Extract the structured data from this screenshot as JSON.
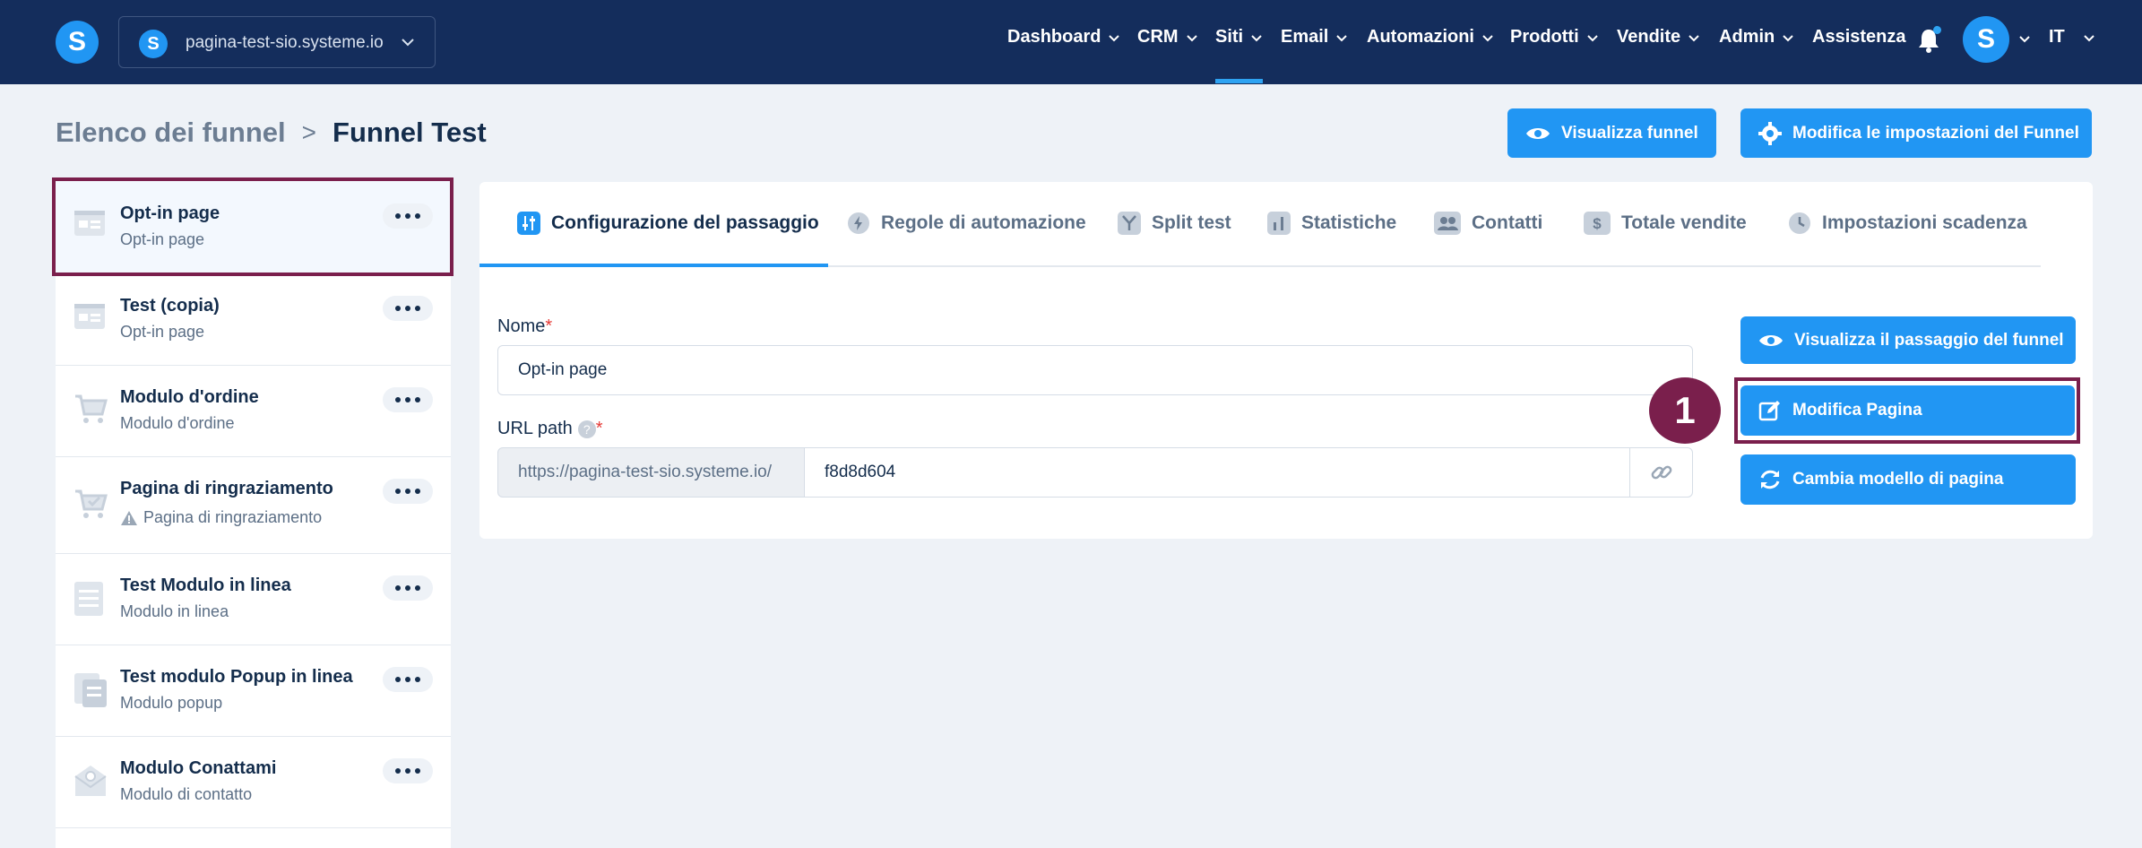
{
  "header": {
    "site_name": "pagina-test-sio.systeme.io",
    "logo_letter": "S",
    "nav": [
      "Dashboard",
      "CRM",
      "Siti",
      "Email",
      "Automazioni",
      "Prodotti",
      "Vendite",
      "Admin",
      "Assistenza"
    ],
    "active_nav": "Siti",
    "language": "IT",
    "avatar_letter": "S"
  },
  "breadcrumb": {
    "parent": "Elenco dei funnel",
    "separator": ">",
    "current": "Funnel Test"
  },
  "top_actions": {
    "view_funnel": "Visualizza funnel",
    "funnel_settings": "Modifica le impostazioni del Funnel"
  },
  "steps": [
    {
      "title": "Opt-in page",
      "subtitle": "Opt-in page",
      "icon": "optin-page-icon",
      "selected": true
    },
    {
      "title": "Test (copia)",
      "subtitle": "Opt-in page",
      "icon": "optin-page-icon"
    },
    {
      "title": "Modulo d'ordine",
      "subtitle": "Modulo d'ordine",
      "icon": "cart-icon"
    },
    {
      "title": "Pagina di ringraziamento",
      "subtitle": "Pagina di ringraziamento",
      "icon": "cart-check-icon",
      "warning": true
    },
    {
      "title": "Test Modulo in linea",
      "subtitle": "Modulo in linea",
      "icon": "form-icon"
    },
    {
      "title": "Test modulo Popup in linea",
      "subtitle": "Modulo popup",
      "icon": "popup-icon"
    },
    {
      "title": "Modulo Conattami",
      "subtitle": "Modulo di contatto",
      "icon": "contact-mail-icon"
    }
  ],
  "tabs": [
    "Configurazione del passaggio",
    "Regole di automazione",
    "Split test",
    "Statistiche",
    "Contatti",
    "Totale vendite",
    "Impostazioni scadenza"
  ],
  "form": {
    "name_label": "Nome",
    "name_value": "Opt-in page",
    "url_label": "URL path",
    "required_mark": "*",
    "help_mark": "?",
    "url_prefix": "https://pagina-test-sio.systeme.io/",
    "url_value": "f8d8d604"
  },
  "side_actions": {
    "view_step": "Visualizza il passaggio del funnel",
    "edit_page": "Modifica Pagina",
    "change_template": "Cambia modello di pagina"
  },
  "annotation": {
    "step_number": "1"
  },
  "colors": {
    "header_bg": "#142d5c",
    "accent": "#2196f3",
    "highlight": "#7a1f4c"
  }
}
